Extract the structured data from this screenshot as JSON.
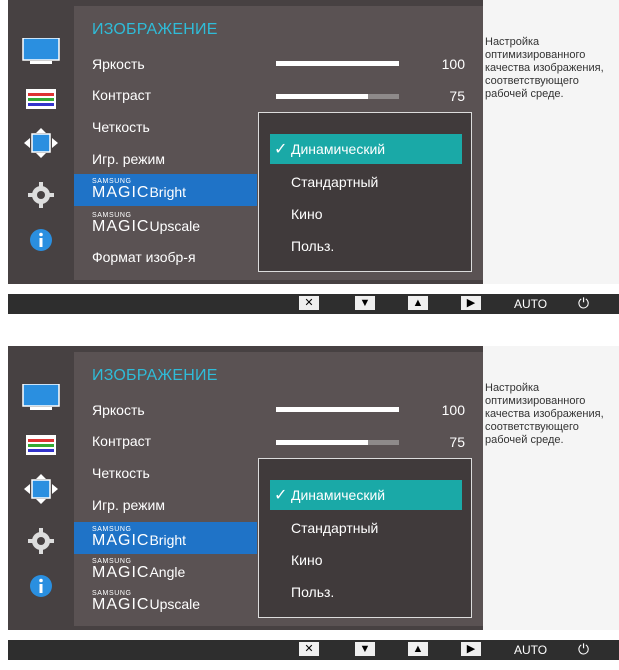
{
  "panels": [
    {
      "menu_title": "ИЗОБРАЖЕНИЕ",
      "rows": [
        {
          "label": "Яркость",
          "value": "100",
          "level": 1.0
        },
        {
          "label": "Контраст",
          "value": "75",
          "level": 0.75
        },
        {
          "label": "Четкость"
        },
        {
          "label": "Игр. режим"
        },
        {
          "magic_small": "SAMSUNG",
          "magic_big": "MAGIC",
          "magic_rest": "Bright",
          "active": true
        },
        {
          "magic_small": "SAMSUNG",
          "magic_big": "MAGIC",
          "magic_rest": "Upscale"
        },
        {
          "label": "Формат изобр-я"
        }
      ],
      "popup": {
        "options": [
          "Динамический",
          "Стандартный",
          "Кино",
          "Польз."
        ],
        "selected_index": 0,
        "check_mark": "✓"
      },
      "description": "Настройка оптимизированного качества изображения, соответствующего рабочей среде.",
      "statusbar": {
        "buttons": [
          "✕",
          "▼",
          "▲",
          "▶"
        ],
        "auto": "AUTO",
        "power": "⏻"
      }
    },
    {
      "menu_title": "ИЗОБРАЖЕНИЕ",
      "rows": [
        {
          "label": "Яркость",
          "value": "100",
          "level": 1.0
        },
        {
          "label": "Контраст",
          "value": "75",
          "level": 0.75
        },
        {
          "label": "Четкость"
        },
        {
          "label": "Игр. режим"
        },
        {
          "magic_small": "SAMSUNG",
          "magic_big": "MAGIC",
          "magic_rest": "Bright",
          "active": true
        },
        {
          "magic_small": "SAMSUNG",
          "magic_big": "MAGIC",
          "magic_rest": "Angle"
        },
        {
          "magic_small": "SAMSUNG",
          "magic_big": "MAGIC",
          "magic_rest": "Upscale"
        }
      ],
      "popup": {
        "options": [
          "Динамический",
          "Стандартный",
          "Кино",
          "Польз."
        ],
        "selected_index": 0,
        "check_mark": "✓"
      },
      "description": "Настройка оптимизированного качества изображения, соответствующего рабочей среде.",
      "statusbar": {
        "buttons": [
          "✕",
          "▼",
          "▲",
          "▶"
        ],
        "auto": "AUTO",
        "power": "⏻"
      }
    }
  ],
  "colors": {
    "title": "#2fbcd8",
    "active_row": "#1f73c7",
    "selected_option": "#1aa9a7"
  },
  "side_icons": [
    "monitor-icon",
    "color-bars-icon",
    "resize-arrows-icon",
    "gear-icon",
    "info-icon"
  ]
}
